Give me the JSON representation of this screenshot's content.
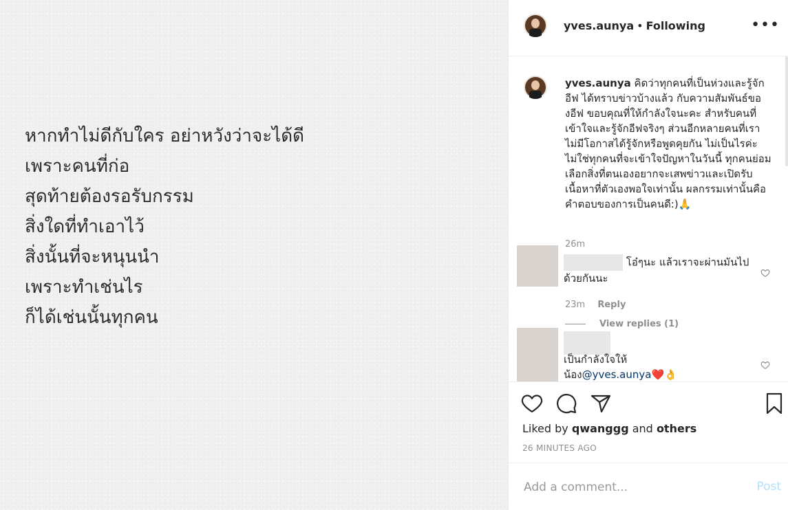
{
  "post": {
    "poem_lines": [
      "หากทำไม่ดีกับใคร อย่าหวังว่าจะได้ดี",
      "เพราะคนที่ก่อ",
      "สุดท้ายต้องรอรับกรรม",
      "สิ่งใดที่ทำเอาไว้",
      "สิ่งนั้นที่จะหนุนนำ",
      "เพราะทำเช่นไร",
      "ก็ได้เช่นนั้นทุกคน"
    ]
  },
  "header": {
    "username": "yves.aunya",
    "separator": "•",
    "follow_status": "Following",
    "more_label": "•••"
  },
  "caption": {
    "username": "yves.aunya",
    "text": "คิดว่าทุกคนที่เป็นห่วงและรู้จักอีฟ ได้ทราบข่าวบ้างแล้ว กับความสัมพันธ์ของอีฟ ขอบคุณที่ให้กำลังใจนะคะ สำหรับคนที่เข้าใจและรู้จักอีฟจริงๆ ส่วนอีกหลายคนที่เราไม่มีโอกาสได้รู้จักหรือพูดคุยกัน ไม่เป็นไรค่ะไม่ใช่ทุกคนที่จะเข้าใจปัญหาในวันนี้ ทุกคนย่อมเลือกสิ่งที่ตนเองอยากจะเสพข่าวและเปิดรับเนื้อหาที่ตัวเองพอใจเท่านั้น ผลกรรมเท่านั้นคือคำตอบของการเป็นคนดี:)🙏",
    "time": "26m"
  },
  "comments": [
    {
      "text": "โอ๋ๆนะ แล้วเราจะผ่านมันไปด้วยกันนะ",
      "time": "23m",
      "reply_label": "Reply",
      "view_replies": "View replies (1)"
    },
    {
      "text": "เป็นกำลังใจให้",
      "text2_prefix": "น้อง",
      "mention": "@yves.aunya",
      "emoji": "❤️👌"
    }
  ],
  "likes": {
    "prefix": "Liked by",
    "user": "qwanggg",
    "and": "and",
    "others": "others"
  },
  "timestamp": "26 MINUTES AGO",
  "add_comment": {
    "placeholder": "Add a comment...",
    "post_label": "Post"
  },
  "colors": {
    "link": "#003569",
    "post_disabled": "#b2dffc",
    "muted": "#8e8e8e"
  }
}
